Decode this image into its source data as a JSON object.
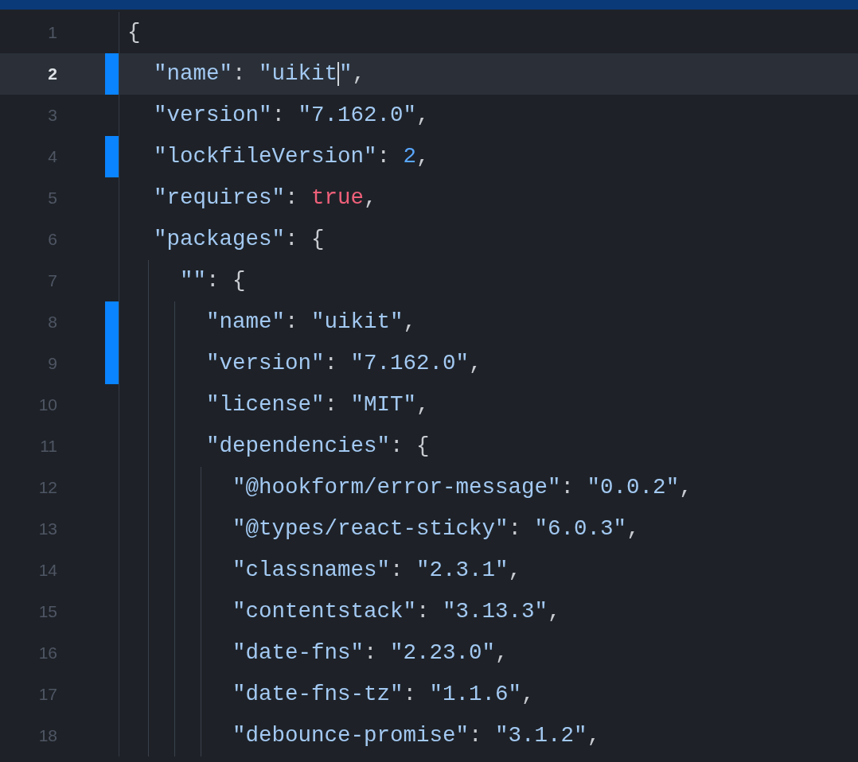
{
  "lines": [
    {
      "number": "1",
      "selected": false,
      "changed": false,
      "tokens": [
        {
          "kind": "punct",
          "text": "{"
        }
      ]
    },
    {
      "number": "2",
      "selected": true,
      "changed": true,
      "tokens": [
        {
          "kind": "key",
          "text": "  \"name\""
        },
        {
          "kind": "punct",
          "text": ": "
        },
        {
          "kind": "string",
          "text": "\"uikit",
          "caret": true
        },
        {
          "kind": "string",
          "text": "\""
        },
        {
          "kind": "punct",
          "text": ","
        }
      ]
    },
    {
      "number": "3",
      "selected": false,
      "changed": false,
      "tokens": [
        {
          "kind": "key",
          "text": "  \"version\""
        },
        {
          "kind": "punct",
          "text": ": "
        },
        {
          "kind": "string",
          "text": "\"7.162.0\""
        },
        {
          "kind": "punct",
          "text": ","
        }
      ]
    },
    {
      "number": "4",
      "selected": false,
      "changed": true,
      "tokens": [
        {
          "kind": "key",
          "text": "  \"lockfileVersion\""
        },
        {
          "kind": "punct",
          "text": ": "
        },
        {
          "kind": "number",
          "text": "2"
        },
        {
          "kind": "punct",
          "text": ","
        }
      ]
    },
    {
      "number": "5",
      "selected": false,
      "changed": false,
      "tokens": [
        {
          "kind": "key",
          "text": "  \"requires\""
        },
        {
          "kind": "punct",
          "text": ": "
        },
        {
          "kind": "boolean",
          "text": "true"
        },
        {
          "kind": "punct",
          "text": ","
        }
      ]
    },
    {
      "number": "6",
      "selected": false,
      "changed": false,
      "tokens": [
        {
          "kind": "key",
          "text": "  \"packages\""
        },
        {
          "kind": "punct",
          "text": ": {"
        }
      ]
    },
    {
      "number": "7",
      "selected": false,
      "changed": false,
      "tokens": [
        {
          "kind": "key",
          "text": "    \"\""
        },
        {
          "kind": "punct",
          "text": ": {"
        }
      ]
    },
    {
      "number": "8",
      "selected": false,
      "changed": true,
      "tokens": [
        {
          "kind": "key",
          "text": "      \"name\""
        },
        {
          "kind": "punct",
          "text": ": "
        },
        {
          "kind": "string",
          "text": "\"uikit\""
        },
        {
          "kind": "punct",
          "text": ","
        }
      ]
    },
    {
      "number": "9",
      "selected": false,
      "changed": true,
      "tokens": [
        {
          "kind": "key",
          "text": "      \"version\""
        },
        {
          "kind": "punct",
          "text": ": "
        },
        {
          "kind": "string",
          "text": "\"7.162.0\""
        },
        {
          "kind": "punct",
          "text": ","
        }
      ]
    },
    {
      "number": "10",
      "selected": false,
      "changed": false,
      "tokens": [
        {
          "kind": "key",
          "text": "      \"license\""
        },
        {
          "kind": "punct",
          "text": ": "
        },
        {
          "kind": "string",
          "text": "\"MIT\""
        },
        {
          "kind": "punct",
          "text": ","
        }
      ]
    },
    {
      "number": "11",
      "selected": false,
      "changed": false,
      "tokens": [
        {
          "kind": "key",
          "text": "      \"dependencies\""
        },
        {
          "kind": "punct",
          "text": ": {"
        }
      ]
    },
    {
      "number": "12",
      "selected": false,
      "changed": false,
      "tokens": [
        {
          "kind": "key",
          "text": "        \"@hookform/error-message\""
        },
        {
          "kind": "punct",
          "text": ": "
        },
        {
          "kind": "string",
          "text": "\"0.0.2\""
        },
        {
          "kind": "punct",
          "text": ","
        }
      ]
    },
    {
      "number": "13",
      "selected": false,
      "changed": false,
      "tokens": [
        {
          "kind": "key",
          "text": "        \"@types/react-sticky\""
        },
        {
          "kind": "punct",
          "text": ": "
        },
        {
          "kind": "string",
          "text": "\"6.0.3\""
        },
        {
          "kind": "punct",
          "text": ","
        }
      ]
    },
    {
      "number": "14",
      "selected": false,
      "changed": false,
      "tokens": [
        {
          "kind": "key",
          "text": "        \"classnames\""
        },
        {
          "kind": "punct",
          "text": ": "
        },
        {
          "kind": "string",
          "text": "\"2.3.1\""
        },
        {
          "kind": "punct",
          "text": ","
        }
      ]
    },
    {
      "number": "15",
      "selected": false,
      "changed": false,
      "tokens": [
        {
          "kind": "key",
          "text": "        \"contentstack\""
        },
        {
          "kind": "punct",
          "text": ": "
        },
        {
          "kind": "string",
          "text": "\"3.13.3\""
        },
        {
          "kind": "punct",
          "text": ","
        }
      ]
    },
    {
      "number": "16",
      "selected": false,
      "changed": false,
      "tokens": [
        {
          "kind": "key",
          "text": "        \"date-fns\""
        },
        {
          "kind": "punct",
          "text": ": "
        },
        {
          "kind": "string",
          "text": "\"2.23.0\""
        },
        {
          "kind": "punct",
          "text": ","
        }
      ]
    },
    {
      "number": "17",
      "selected": false,
      "changed": false,
      "tokens": [
        {
          "kind": "key",
          "text": "        \"date-fns-tz\""
        },
        {
          "kind": "punct",
          "text": ": "
        },
        {
          "kind": "string",
          "text": "\"1.1.6\""
        },
        {
          "kind": "punct",
          "text": ","
        }
      ]
    },
    {
      "number": "18",
      "selected": false,
      "changed": false,
      "tokens": [
        {
          "kind": "key",
          "text": "        \"debounce-promise\""
        },
        {
          "kind": "punct",
          "text": ": "
        },
        {
          "kind": "string",
          "text": "\"3.1.2\""
        },
        {
          "kind": "punct",
          "text": ","
        }
      ]
    }
  ]
}
